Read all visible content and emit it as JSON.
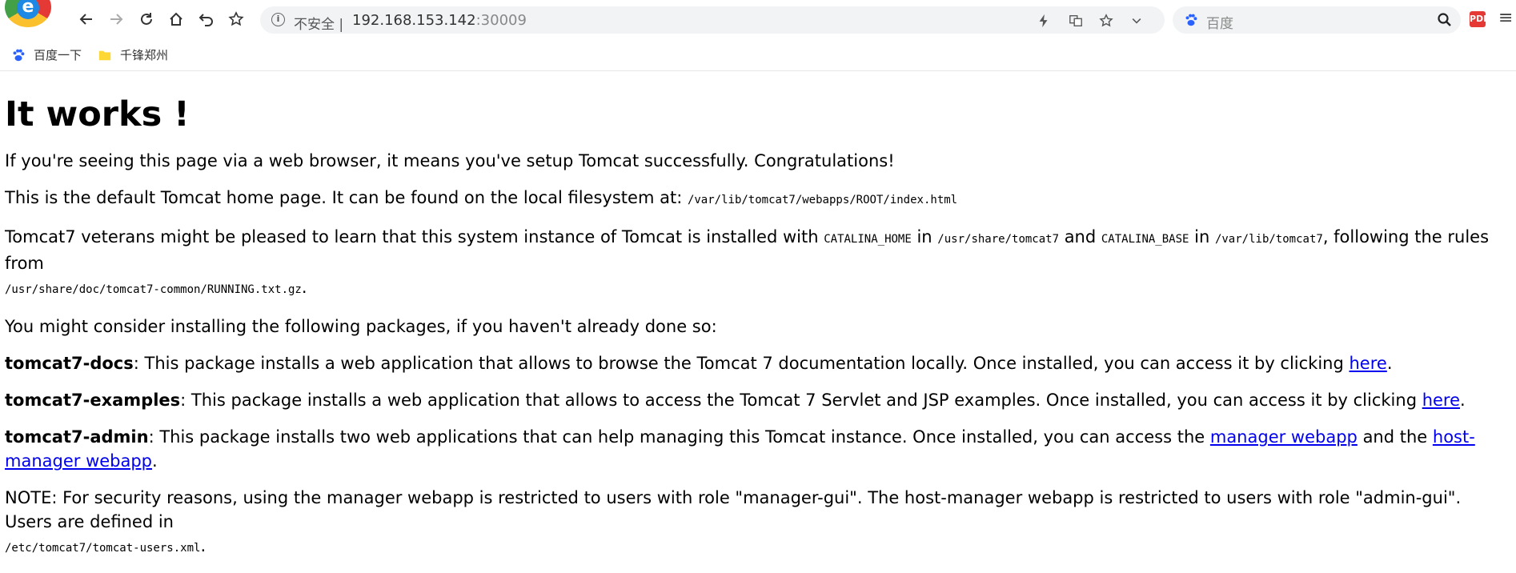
{
  "browser": {
    "security_label": "不安全 |",
    "url_host": "192.168.153.142",
    "url_port": ":30009",
    "search_placeholder": "百度",
    "pdf_label": "PDF"
  },
  "bookmarks": [
    {
      "label": "百度一下"
    },
    {
      "label": "千锋郑州"
    }
  ],
  "page": {
    "heading": "It works !",
    "p1": "If you're seeing this page via a web browser, it means you've setup Tomcat successfully. Congratulations!",
    "p2_text": "This is the default Tomcat home page. It can be found on the local filesystem at: ",
    "p2_path": "/var/lib/tomcat7/webapps/ROOT/index.html",
    "p3_a": "Tomcat7 veterans might be pleased to learn that this system instance of Tomcat is installed with ",
    "p3_catalina_home": "CATALINA_HOME",
    "p3_b": " in ",
    "p3_home_path": "/usr/share/tomcat7",
    "p3_c": " and ",
    "p3_catalina_base": "CATALINA_BASE",
    "p3_d": " in ",
    "p3_base_path": "/var/lib/tomcat7",
    "p3_e": ", following the rules from",
    "p3_running": "/usr/share/doc/tomcat7-common/RUNNING.txt.gz",
    "p3_f": ".",
    "p4": "You might consider installing the following packages, if you haven't already done so:",
    "docs_name": "tomcat7-docs",
    "docs_text": ": This package installs a web application that allows to browse the Tomcat 7 documentation locally. Once installed, you can access it by clicking ",
    "docs_link": "here",
    "examples_name": "tomcat7-examples",
    "examples_text": ": This package installs a web application that allows to access the Tomcat 7 Servlet and JSP examples. Once installed, you can access it by clicking ",
    "examples_link": "here",
    "admin_name": "tomcat7-admin",
    "admin_text": ": This package installs two web applications that can help managing this Tomcat instance. Once installed, you can access the ",
    "admin_link1": "manager webapp",
    "admin_mid": " and the ",
    "admin_link2": "host-manager webapp",
    "note_text": "NOTE: For security reasons, using the manager webapp is restricted to users with role \"manager-gui\". The host-manager webapp is restricted to users with role \"admin-gui\". Users are defined in",
    "note_path": "/etc/tomcat7/tomcat-users.xml",
    "period": "."
  }
}
